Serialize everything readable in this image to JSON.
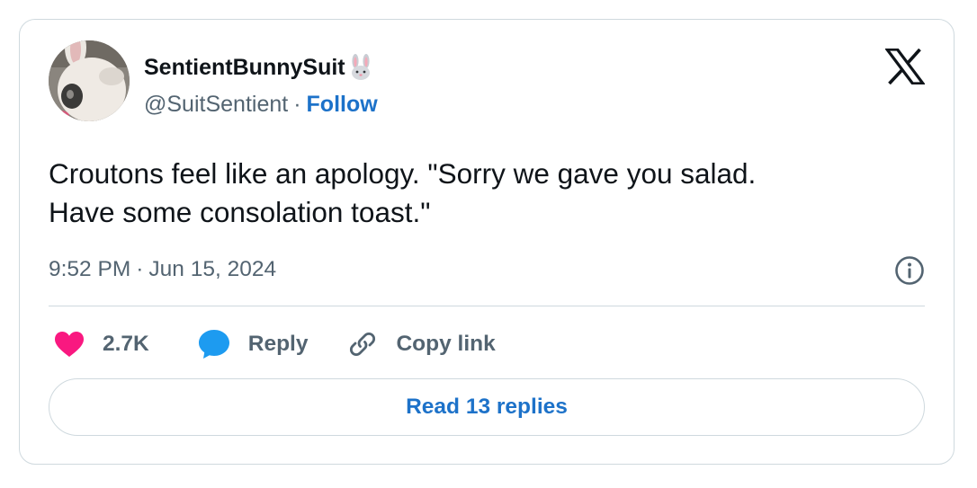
{
  "author": {
    "display_name": "SentientBunnySuit",
    "name_emoji": "rabbit-face-emoji",
    "handle": "@SuitSentient",
    "separator": "·",
    "follow_label": "Follow"
  },
  "tweet": {
    "text": "Croutons feel like an apology. \"Sorry we gave you salad.\nHave some consolation toast.\"",
    "time": "9:52 PM",
    "separator": "·",
    "date": "Jun 15, 2024"
  },
  "actions": {
    "like_count": "2.7K",
    "reply_label": "Reply",
    "copy_link_label": "Copy link"
  },
  "read_replies_label": "Read 13 replies",
  "icons": {
    "platform_logo": "x-logo-icon",
    "info": "info-icon",
    "like": "heart-icon",
    "reply": "speech-bubble-icon",
    "copy_link": "link-icon"
  },
  "colors": {
    "link_blue": "#1d72c9",
    "like_pink": "#f91880",
    "reply_blue": "#1d9bf0",
    "text_primary": "#0f1419",
    "text_secondary": "#536471",
    "border": "#cfd9de"
  }
}
